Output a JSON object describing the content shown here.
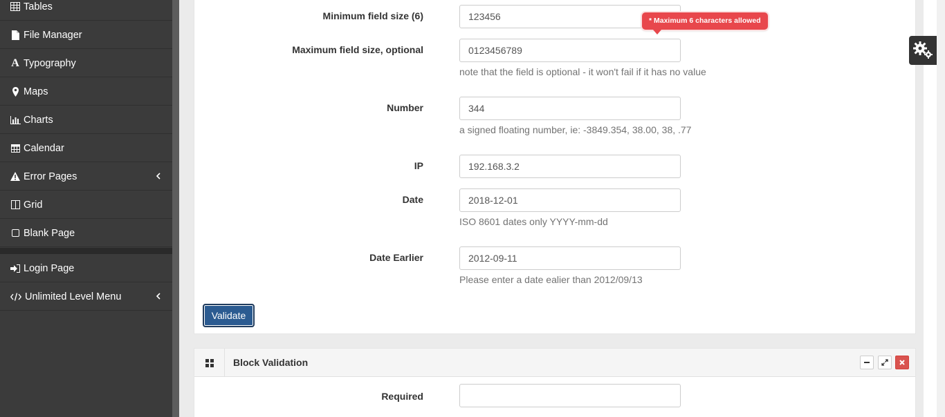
{
  "sidebar": {
    "items": [
      {
        "label": "Tables",
        "icon": "table-icon",
        "has_submenu": false
      },
      {
        "label": "File Manager",
        "icon": "file-icon",
        "has_submenu": false
      },
      {
        "label": "Typography",
        "icon": "font-icon",
        "has_submenu": false
      },
      {
        "label": "Maps",
        "icon": "map-marker-icon",
        "has_submenu": false
      },
      {
        "label": "Charts",
        "icon": "bar-chart-icon",
        "has_submenu": false
      },
      {
        "label": "Calendar",
        "icon": "calendar-icon",
        "has_submenu": false
      },
      {
        "label": "Error Pages",
        "icon": "warning-icon",
        "has_submenu": true
      },
      {
        "label": "Grid",
        "icon": "columns-icon",
        "has_submenu": false
      },
      {
        "label": "Blank Page",
        "icon": "square-icon",
        "has_submenu": false
      }
    ],
    "bottom_items": [
      {
        "label": "Login Page",
        "icon": "sign-in-icon",
        "has_submenu": false
      },
      {
        "label": "Unlimited Level Menu",
        "icon": "code-icon",
        "has_submenu": true
      }
    ]
  },
  "form": {
    "min_size": {
      "label": "Minimum field size (6)",
      "value": "123456"
    },
    "max_size": {
      "label": "Maximum field size, optional",
      "value": "0123456789",
      "help": "note that the field is optional - it won't fail if it has no value"
    },
    "number": {
      "label": "Number",
      "value": "344",
      "help": "a signed floating number, ie: -3849.354, 38.00, 38, .77"
    },
    "ip": {
      "label": "IP",
      "value": "192.168.3.2"
    },
    "date": {
      "label": "Date",
      "value": "2018-12-01",
      "help": "ISO 8601 dates only YYYY-mm-dd"
    },
    "date_earlier": {
      "label": "Date Earlier",
      "value": "2012-09-11",
      "help": "Please enter a date ealier than 2012/09/13"
    },
    "validate_label": "Validate",
    "tooltip": "* Maximum 6 characters allowed"
  },
  "block_panel": {
    "title": "Block Validation",
    "required": {
      "label": "Required",
      "value": ""
    }
  },
  "colors": {
    "sidebar_bg": "#3b3b3b",
    "primary_button": "#2b5b91",
    "tooltip_red": "#e8474c",
    "close_red": "#d9534f"
  }
}
